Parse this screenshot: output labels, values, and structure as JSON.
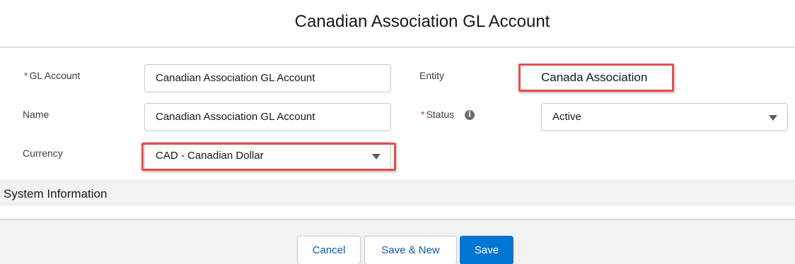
{
  "header": {
    "title": "Canadian Association GL Account"
  },
  "form": {
    "gl_account": {
      "label": "GL Account",
      "value": "Canadian Association GL Account",
      "required": "*"
    },
    "name": {
      "label": "Name",
      "value": "Canadian Association GL Account"
    },
    "currency": {
      "label": "Currency",
      "value": "CAD - Canadian Dollar"
    },
    "entity": {
      "label": "Entity",
      "value": "Canada Association"
    },
    "status": {
      "label": "Status",
      "value": "Active",
      "required": "*",
      "info_icon": "i"
    }
  },
  "section": {
    "title": "System Information"
  },
  "footer": {
    "cancel_label": "Cancel",
    "save_new_label": "Save & New",
    "save_label": "Save"
  },
  "colors": {
    "brand": "#0176d3",
    "highlight": "#e84c4c",
    "required": "#c23934"
  }
}
